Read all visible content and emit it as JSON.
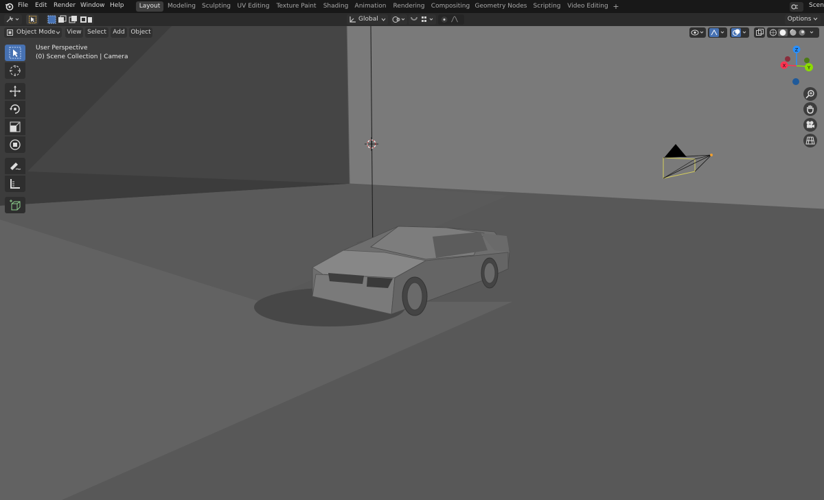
{
  "menu": {
    "items": [
      "File",
      "Edit",
      "Render",
      "Window",
      "Help"
    ]
  },
  "workspaces": [
    "Layout",
    "Modeling",
    "Sculpting",
    "UV Editing",
    "Texture Paint",
    "Shading",
    "Animation",
    "Rendering",
    "Compositing",
    "Geometry Nodes",
    "Scripting",
    "Video Editing"
  ],
  "workspace_add": "+",
  "scene_label": "Scen",
  "header": {
    "mode": "Object Mode",
    "view": "View",
    "select": "Select",
    "add": "Add",
    "object": "Object",
    "orientation": "Global",
    "options": "Options"
  },
  "viewport": {
    "title": "User Perspective",
    "collection": "(0) Scene Collection | Camera"
  },
  "gizmo": {
    "z_label": "Z",
    "x_label": "X",
    "y_label": "Y"
  },
  "colors": {
    "accent": "#4772b3",
    "x_axis": "#ff3352",
    "y_axis": "#8bdc00",
    "z_axis": "#2890ff",
    "camera_selected": "#d7d05c"
  },
  "icons": [
    "blender-logo-icon",
    "select-box-icon",
    "cursor-icon",
    "move-icon",
    "rotate-icon",
    "scale-icon",
    "transform-icon",
    "annotate-icon",
    "measure-icon",
    "add-cube-icon",
    "zoom-icon",
    "pan-hand-icon",
    "camera-view-icon",
    "ortho-grid-icon"
  ]
}
